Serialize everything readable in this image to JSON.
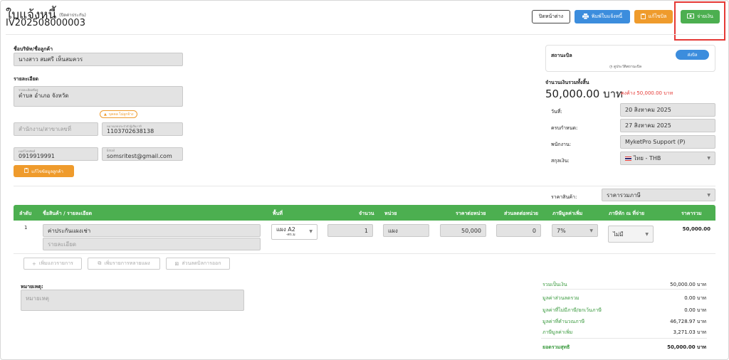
{
  "header": {
    "title": "ใบแจ้งหนี้",
    "subtitle": "(ปิดค่าประกัน)",
    "doc_no": "IV202508000003"
  },
  "toolbar": {
    "close": "ปิดหน้าต่าง",
    "print": "พิมพ์ใบแจ้งหนี้",
    "edit": "แก้ไขบิล",
    "pay": "จ่ายเงิน"
  },
  "customer": {
    "name_label": "ชื่อบริษัท/ชื่อลูกค้า",
    "name": "นางสาว สมศรี เห็นสมควร",
    "detail_label": "รายละเอียด",
    "address_hint": "รายละเอียดที่อยู่",
    "address": "ตำบล อำเภอ จังหวัด",
    "badge": "บุคคล ไม่ลูกจ้าง",
    "branch_placeholder": "สำนักงาน/สาขาเลขที่",
    "tax_hint": "หมายเลขประจำตัวผู้เสียภาษี",
    "tax_id": "1103702638138",
    "phone_hint": "เบอร์โทรศัพท์",
    "phone": "0919919991",
    "email_hint": "Email",
    "email": "somsritest@gmail.com",
    "edit_button": "แก้ไขข้อมูลลูกค้า"
  },
  "status": {
    "label": "สถานะบิล",
    "value": "ส่งบิล",
    "history": "ดูประวัติสถานะบิล"
  },
  "total": {
    "label": "จำนวนเงินรวมทั้งสิ้น",
    "amount": "50,000.00 บาท",
    "outstanding": "คงค้าง 50,000.00 บาท"
  },
  "meta": {
    "date_label": "วันที่:",
    "date": "20 สิงหาคม 2025",
    "due_label": "ครบกำหนด:",
    "due": "27 สิงหาคม 2025",
    "staff_label": "พนักงาน:",
    "staff": "MyketPro Support (P)",
    "currency_label": "สกุลเงิน:",
    "currency": "ไทย - THB",
    "price_label": "ราคาสินค้า:",
    "price_type": "ราคารวมภาษี"
  },
  "table": {
    "headers": [
      "ลำดับ",
      "ชื่อสินค้า / รายละเอียด",
      "พื้นที่",
      "จำนวน",
      "หน่วย",
      "ราคาต่อหน่วย",
      "ส่วนลดต่อหน่วย",
      "ภาษีมูลค่าเพิ่ม",
      "ภาษีหัก ณ ที่จ่าย",
      "ราคารวม"
    ],
    "row": {
      "no": "1",
      "name": "ค่าประกันแผงเช่า",
      "detail_placeholder": "รายละเอียด",
      "area": "แผง A2",
      "area_sub": "-ตร.ม",
      "qty": "1",
      "unit": "แผง",
      "price": "50,000",
      "discount": "0",
      "vat": "7%",
      "wht": "ไม่มี",
      "total": "50,000.00"
    }
  },
  "actions": {
    "add_row": "เพิ่มแถวรายการ",
    "add_many": "เพิ่มรายการหลายแผง",
    "discount": "ส่วนลดบิลการออก"
  },
  "notes": {
    "label": "หมายเหตุ:",
    "placeholder": "หมายเหตุ"
  },
  "summary": [
    {
      "label": "รวมเป็นเงิน",
      "value": "50,000.00 บาท"
    },
    {
      "label": "มูลค่าส่วนลดรวม",
      "value": "0.00 บาท"
    },
    {
      "label": "มูลค่าที่ไม่มีภาษี/ยกเว้นภาษี",
      "value": "0.00 บาท"
    },
    {
      "label": "มูลค่าที่คำนวณภาษี",
      "value": "46,728.97 บาท"
    },
    {
      "label": "ภาษีมูลค่าเพิ่ม",
      "value": "3,271.03 บาท"
    },
    {
      "label": "ยอดรวมสุทธิ",
      "value": "50,000.00 บาท"
    }
  ],
  "colors": {
    "green": "#4caf50",
    "blue": "#3c8ddd",
    "orange": "#ef9b2c",
    "red": "#e53935"
  }
}
